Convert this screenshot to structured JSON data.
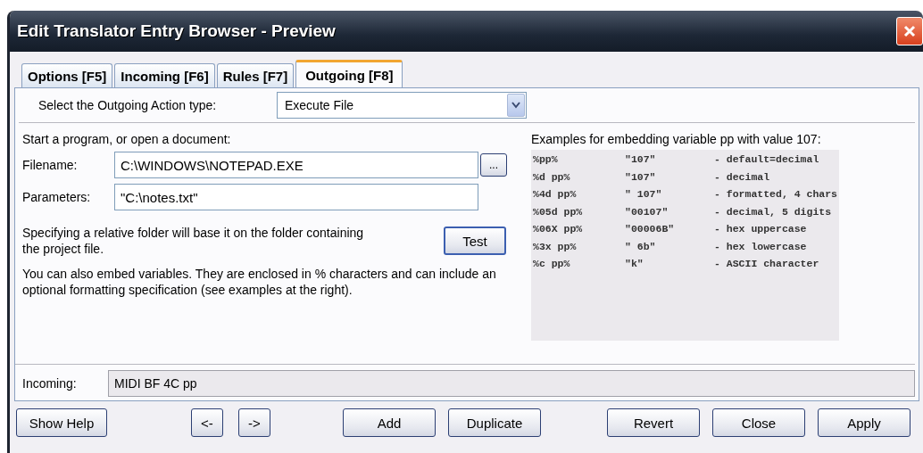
{
  "window": {
    "title": "Edit Translator Entry Browser - Preview"
  },
  "tabs": [
    {
      "label": "Options [F5]",
      "selected": false
    },
    {
      "label": "Incoming [F6]",
      "selected": false
    },
    {
      "label": "Rules [F7]",
      "selected": false
    },
    {
      "label": "Outgoing [F8]",
      "selected": true
    }
  ],
  "action_type": {
    "label": "Select the Outgoing Action type:",
    "value": "Execute File"
  },
  "program": {
    "heading": "Start a program, or open a document:",
    "filename_label": "Filename:",
    "filename": "C:\\WINDOWS\\NOTEPAD.EXE",
    "browse_button": "...",
    "parameters_label": "Parameters:",
    "parameters": "\"C:\\notes.txt\"",
    "note": "Specifying a relative folder will base it on the folder containing the project file.",
    "test_button": "Test",
    "variables_note": "You can also embed variables. They are enclosed in % characters and can include an optional formatting specification (see examples at the right)."
  },
  "examples": {
    "heading": "Examples for embedding variable pp with value 107:",
    "rows": [
      {
        "format": "%pp%",
        "result": "\"107\"",
        "description": "- default=decimal"
      },
      {
        "format": "%d pp%",
        "result": "\"107\"",
        "description": "- decimal"
      },
      {
        "format": "%4d pp%",
        "result": "\" 107\"",
        "description": "- formatted, 4 chars"
      },
      {
        "format": "%05d pp%",
        "result": "\"00107\"",
        "description": "- decimal, 5 digits"
      },
      {
        "format": "%06X pp%",
        "result": "\"00006B\"",
        "description": "- hex uppercase"
      },
      {
        "format": "%3x pp%",
        "result": "\" 6b\"",
        "description": "- hex lowercase"
      },
      {
        "format": "%c pp%",
        "result": "\"k\"",
        "description": "- ASCII character"
      }
    ]
  },
  "incoming": {
    "label": "Incoming:",
    "value": "MIDI BF 4C pp"
  },
  "buttons": [
    [
      "Show Help"
    ],
    [
      "<-",
      "->"
    ],
    [
      "Add",
      "Duplicate"
    ],
    [
      "Revert",
      "Close",
      "Apply"
    ]
  ]
}
